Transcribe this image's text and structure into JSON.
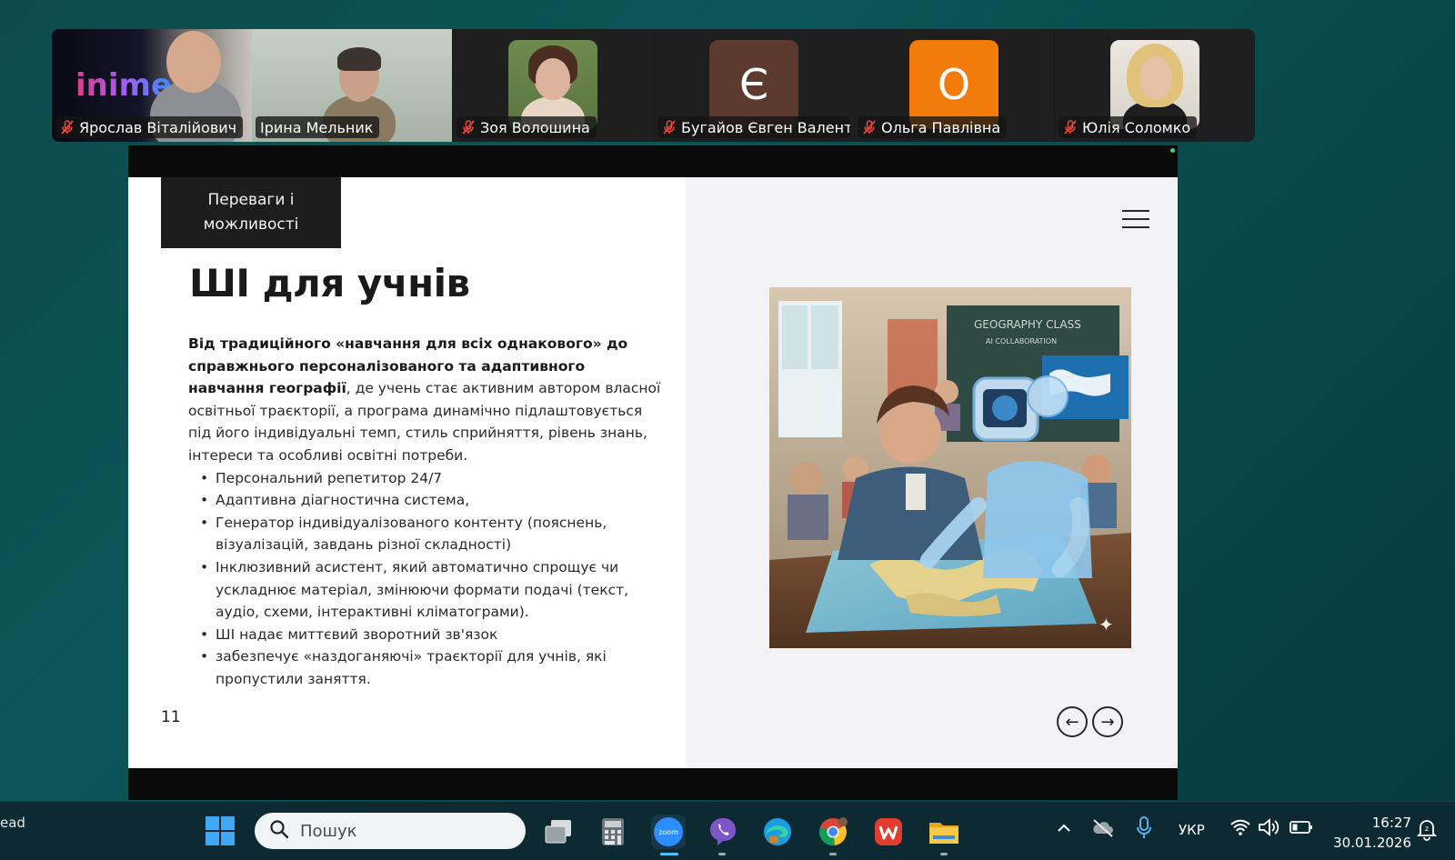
{
  "participants": [
    {
      "name": "Ярослав Віталійович",
      "muted": true,
      "kind": "video",
      "brand_text": "inime"
    },
    {
      "name": "Ірина Мельник",
      "muted": false,
      "kind": "video",
      "active": true
    },
    {
      "name": "Зоя Волошина",
      "muted": true,
      "kind": "photo"
    },
    {
      "name": "Бугайов Євген Валент...",
      "muted": true,
      "kind": "letter",
      "letter": "Є",
      "color": "#5c3a2f"
    },
    {
      "name": "Ольга Павлівна",
      "muted": true,
      "kind": "letter",
      "letter": "О",
      "color": "#f27b0c"
    },
    {
      "name": "Юлія Соломко",
      "muted": true,
      "kind": "photo"
    }
  ],
  "slide": {
    "section_tag": "Переваги і можливості",
    "title": "ШІ для учнів",
    "intro_bold": "Від традиційного «навчання для всіх однакового» до справжнього персоналізованого та адаптивного навчання географії",
    "intro_rest": ", де учень стає активним автором власної освітньої траєкторії, а програма динамічно підлаштовується під його індивідуальні темп, стиль сприйняття, рівень знань, інтереси та особливі освітні потреби.",
    "bullets": [
      "Персональний репетитор 24/7",
      "Адаптивна діагностична система,",
      "Генератор індивідуалізованого контенту (пояснень, візуалізацій, завдань різної складності)",
      "Інклюзивний асистент, який автоматично спрощує чи ускладнює матеріал, змінюючи формати подачі (текст, аудіо, схеми, інтерактивні кліматограми).",
      "ШІ надає миттєвий зворотний зв'язок",
      "забезпечує «наздоганяючі» траєкторії для учнів, які пропустили заняття."
    ],
    "page_number": "11",
    "image_board_text": "GEOGRAPHY CLASS",
    "image_board_subtext": "AI COLLABORATION",
    "nav_prev": "←",
    "nav_next": "→"
  },
  "taskbar": {
    "left_text": "ead",
    "search_placeholder": "Пошук",
    "language": "УКР",
    "time": "16:27",
    "date": "30.01.2026",
    "apps": [
      "task-view-icon",
      "calculator-icon",
      "zoom-icon",
      "viber-icon",
      "edge-icon",
      "chrome-icon",
      "wps-icon",
      "file-explorer-icon"
    ]
  },
  "colors": {
    "active_speaker": "#2fd18a",
    "accent_blue": "#4cc2ff"
  }
}
